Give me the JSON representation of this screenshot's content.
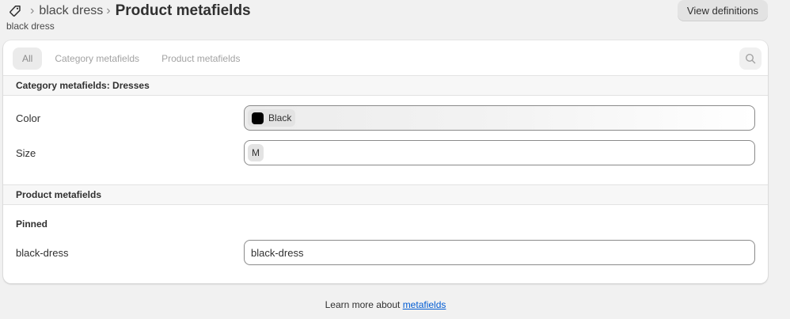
{
  "header": {
    "breadcrumb_product": "black dress",
    "title": "Product metafields",
    "subtitle": "black dress",
    "view_definitions_label": "View definitions"
  },
  "tabs": [
    {
      "label": "All",
      "active": true
    },
    {
      "label": "Category metafields",
      "active": false
    },
    {
      "label": "Product metafields",
      "active": false
    }
  ],
  "category_section": {
    "title": "Category metafields: Dresses",
    "color": {
      "label": "Color",
      "value": "Black",
      "swatch": "#000000"
    },
    "size": {
      "label": "Size",
      "value": "M"
    }
  },
  "product_section": {
    "title": "Product metafields",
    "pinned_label": "Pinned",
    "field": {
      "label": "black-dress",
      "value": "black-dress"
    }
  },
  "footer": {
    "text": "Learn more about",
    "link": "metafields",
    "link_color": "#005bd3"
  }
}
